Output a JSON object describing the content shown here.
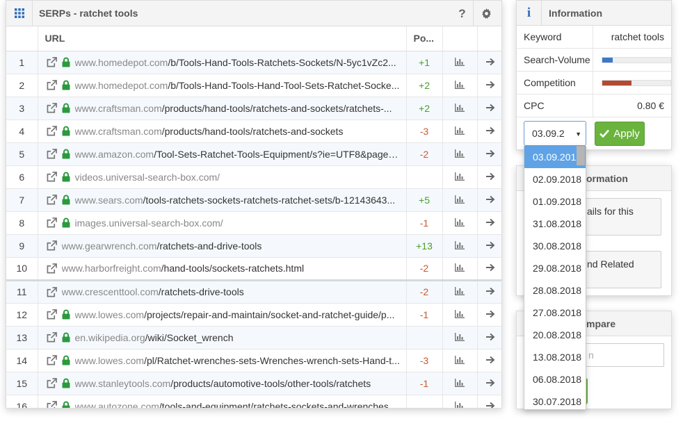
{
  "serp_panel": {
    "title": "SERPs - ratchet tools",
    "help_label": "?",
    "columns": {
      "url": "URL",
      "position": "Po..."
    },
    "rows": [
      {
        "num": "1",
        "domain": "www.homedepot.com",
        "path": "/b/Tools-Hand-Tools-Ratchets-Sockets/N-5yc1vZc2...",
        "secure": true,
        "change": "+1",
        "dir": "up"
      },
      {
        "num": "2",
        "domain": "www.homedepot.com",
        "path": "/b/Tools-Hand-Tools-Hand-Tool-Sets-Ratchet-Socke...",
        "secure": true,
        "change": "+2",
        "dir": "up"
      },
      {
        "num": "3",
        "domain": "www.craftsman.com",
        "path": "/products/hand-tools/ratchets-and-sockets/ratchets-...",
        "secure": true,
        "change": "+2",
        "dir": "up"
      },
      {
        "num": "4",
        "domain": "www.craftsman.com",
        "path": "/products/hand-tools/ratchets-and-sockets",
        "secure": true,
        "change": "-3",
        "dir": "down"
      },
      {
        "num": "5",
        "domain": "www.amazon.com",
        "path": "/Tool-Sets-Ratchet-Tools-Equipment/s?ie=UTF8&page=...",
        "secure": true,
        "change": "-2",
        "dir": "down"
      },
      {
        "num": "6",
        "domain": "videos.universal-search-box.com/",
        "path": "",
        "secure": true,
        "change": "",
        "dir": "none"
      },
      {
        "num": "7",
        "domain": "www.sears.com",
        "path": "/tools-ratchets-sockets-ratchets-ratchet-sets/b-12143643...",
        "secure": true,
        "change": "+5",
        "dir": "up"
      },
      {
        "num": "8",
        "domain": "images.universal-search-box.com/",
        "path": "",
        "secure": true,
        "change": "-1",
        "dir": "down"
      },
      {
        "num": "9",
        "domain": "www.gearwrench.com",
        "path": "/ratchets-and-drive-tools",
        "secure": false,
        "change": "+13",
        "dir": "up"
      },
      {
        "num": "10",
        "domain": "www.harborfreight.com",
        "path": "/hand-tools/sockets-ratchets.html",
        "secure": false,
        "change": "-2",
        "dir": "down"
      },
      {
        "num": "11",
        "domain": "www.crescenttool.com",
        "path": "/ratchets-drive-tools",
        "secure": false,
        "change": "-2",
        "dir": "down"
      },
      {
        "num": "12",
        "domain": "www.lowes.com",
        "path": "/projects/repair-and-maintain/socket-and-ratchet-guide/p...",
        "secure": true,
        "change": "-1",
        "dir": "down"
      },
      {
        "num": "13",
        "domain": "en.wikipedia.org",
        "path": "/wiki/Socket_wrench",
        "secure": true,
        "change": "",
        "dir": "none"
      },
      {
        "num": "14",
        "domain": "www.lowes.com",
        "path": "/pl/Ratchet-wrenches-sets-Wrenches-wrench-sets-Hand-t...",
        "secure": true,
        "change": "-3",
        "dir": "down"
      },
      {
        "num": "15",
        "domain": "www.stanleytools.com",
        "path": "/products/automotive-tools/other-tools/ratchets",
        "secure": true,
        "change": "-1",
        "dir": "down"
      },
      {
        "num": "16",
        "domain": "www.autozone.com",
        "path": "/tools-and-equipment/ratchets-sockets-and-wrenches...",
        "secure": true,
        "change": "",
        "dir": "none"
      }
    ]
  },
  "info_panel": {
    "icon": "i",
    "title": "Information",
    "keyword_label": "Keyword",
    "keyword_value": "ratchet tools",
    "search_volume_label": "Search-Volume",
    "search_volume_level": 0.15,
    "competition_label": "Competition",
    "competition_level": 0.43,
    "cpc_label": "CPC",
    "cpc_value": "0.80 €",
    "date_value": "03.09.2",
    "apply_label": "Apply"
  },
  "hidden_panels": {
    "details_header": "ormation",
    "details_button": "ails for this",
    "related_button": "nd Related",
    "compare_header": "mpare",
    "compare_input": "n"
  },
  "date_dropdown": {
    "selected_index": 0,
    "options": [
      "03.09.2018",
      "02.09.2018",
      "01.09.2018",
      "31.08.2018",
      "30.08.2018",
      "29.08.2018",
      "28.08.2018",
      "27.08.2018",
      "20.08.2018",
      "13.08.2018",
      "06.08.2018",
      "30.07.2018"
    ]
  },
  "colors": {
    "accent_blue": "#2e6fbb",
    "up_green": "#4b9e2c",
    "down_orange": "#c9582b",
    "search_volume_bar": "#3d78c7",
    "competition_bar": "#b24a34",
    "apply_green": "#6ab33e"
  },
  "icons": {
    "grid": "grid-icon",
    "help": "help-icon",
    "gear": "gear-icon",
    "external": "external-link-icon",
    "lock": "lock-icon",
    "chart": "bar-chart-icon",
    "arrow": "arrow-right-icon",
    "info": "info-icon",
    "check": "check-icon"
  }
}
